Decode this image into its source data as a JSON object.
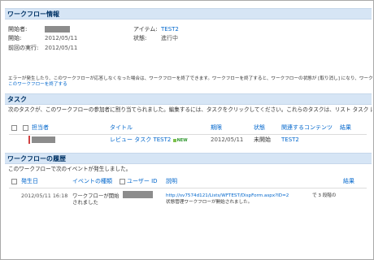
{
  "workflow_info": {
    "header": "ワークフロー情報",
    "initiator_label": "開始者:",
    "item_label": "アイテム:",
    "item_value": "TEST2",
    "started_label": "開始:",
    "started_value": "2012/05/11",
    "status_label": "状態:",
    "status_value": "進行中",
    "last_run_label": "前回の実行:",
    "last_run_value": "2012/05/11",
    "error_note_line1": "エラーが発生したり、このワークフローが応答しなくなった場合は、ワークフローを終了できます。ワークフローを終了すると、ワークフローの状態が [取り消し] になり、ワークフロー",
    "error_note_line2_link": "このワークフローを終了する"
  },
  "tasks": {
    "header": "タスク",
    "description": "次のタスクが、このワークフローの参加者に割り当てられました。編集するには、タスクをクリックしてください。これらのタスクは、リスト タスク にも表示されています。",
    "columns": [
      "担当者",
      "タイトル",
      "期限",
      "状態",
      "関連するコンテンツ",
      "結果"
    ],
    "rows": [
      {
        "title": "レビュー タスク TEST2",
        "badge": "NEW",
        "due": "2012/05/11",
        "status": "未開始",
        "related": "TEST2",
        "outcome": ""
      }
    ]
  },
  "history": {
    "header": "ワークフローの履歴",
    "description": "このワークフローで次のイベントが発生しました。",
    "columns": [
      "発生日",
      "イベントの種類",
      "ユーザー ID",
      "説明",
      "結果"
    ],
    "rows": [
      {
        "date": "2012/05/11 16:18",
        "event_line1": "ワークフローが開始",
        "event_line2": "されました",
        "desc_link": "http://sv7574d121/Lists/WFTEST/DispForm.aspx?ID=2",
        "desc_text1": "で 3 段階の",
        "desc_text2": "状態管理ワークフローが開始されました。",
        "outcome": ""
      }
    ]
  },
  "colors": {
    "section_header_bg": "#d6e5f5",
    "link": "#0066cc",
    "redacted": "#8c8c8c"
  }
}
